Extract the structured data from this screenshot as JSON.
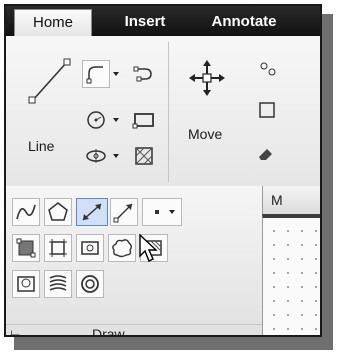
{
  "tabs": [
    {
      "label": "Home",
      "active": true
    },
    {
      "label": "Insert",
      "active": false
    },
    {
      "label": "Annotate",
      "active": false
    }
  ],
  "draw_panel": {
    "line_label": "Line",
    "title": "Draw"
  },
  "modify_panel": {
    "move_label": "Move"
  },
  "viewport": {
    "tab_label": "M"
  },
  "colors": {
    "ribbon_bg": "#1a1a1a",
    "panel_bg": "#ececec",
    "selection": "#cfe0f7",
    "selection_border": "#5a88c9"
  }
}
